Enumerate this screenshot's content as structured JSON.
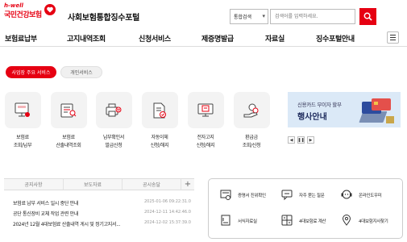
{
  "header": {
    "logo_tagline": "h-well",
    "logo_name": "국민건강보험",
    "portal_title": "사회보험통합징수포털",
    "search_scope": "통합검색",
    "search_placeholder": "검색어를 입력하세요."
  },
  "nav": {
    "items": [
      "보험료납부",
      "고지내역조회",
      "신청서비스",
      "제증명발급",
      "자료실",
      "징수포털안내"
    ]
  },
  "tabs": [
    "사업장 주요 서비스",
    "개인서비스"
  ],
  "services": [
    {
      "label": "보험료\n조회/납부",
      "icon": "monitor-payment-icon"
    },
    {
      "label": "보험료\n산출내역조회",
      "icon": "calculator-search-icon"
    },
    {
      "label": "납부확인서\n발급신청",
      "icon": "printer-certificate-icon"
    },
    {
      "label": "자동이체\n신청/해지",
      "icon": "document-check-icon"
    },
    {
      "label": "전자고지\n신청/해지",
      "icon": "computer-notice-icon"
    },
    {
      "label": "환급금\n조회/신청",
      "icon": "hand-coin-icon"
    }
  ],
  "banner": {
    "line1": "신용카드 무이자 할부",
    "line2": "행사안내"
  },
  "notice": {
    "tabs": [
      "공지사항",
      "보도자료",
      "공시송달"
    ],
    "rows": [
      {
        "title": "보험료 납부 서비스 일시 중단 안내",
        "date": "2025-01-06 09:22:31.0"
      },
      {
        "title": "공단 통신장비 교체 작업 관련 안내",
        "date": "2024-12-11 14:42:46.0"
      },
      {
        "title": "2024년 12월 4대보험료 산출내역 게시 및 정기고지서...",
        "date": "2024-12-02 15:37:39.0"
      }
    ]
  },
  "quick_links": [
    {
      "label": "증명서 진위확인",
      "icon": "certificate-verify-icon"
    },
    {
      "label": "자주 묻는 질문",
      "icon": "faq-chat-icon"
    },
    {
      "label": "온라인도우미",
      "icon": "online-helper-icon"
    },
    {
      "label": "서식자료실",
      "icon": "form-library-icon"
    },
    {
      "label": "4대보험료 계산",
      "icon": "calculator-icon"
    },
    {
      "label": "4대보험지사찾기",
      "icon": "location-pin-icon"
    }
  ],
  "colors": {
    "accent": "#e60012",
    "banner_bg": "#dbe9f7"
  }
}
